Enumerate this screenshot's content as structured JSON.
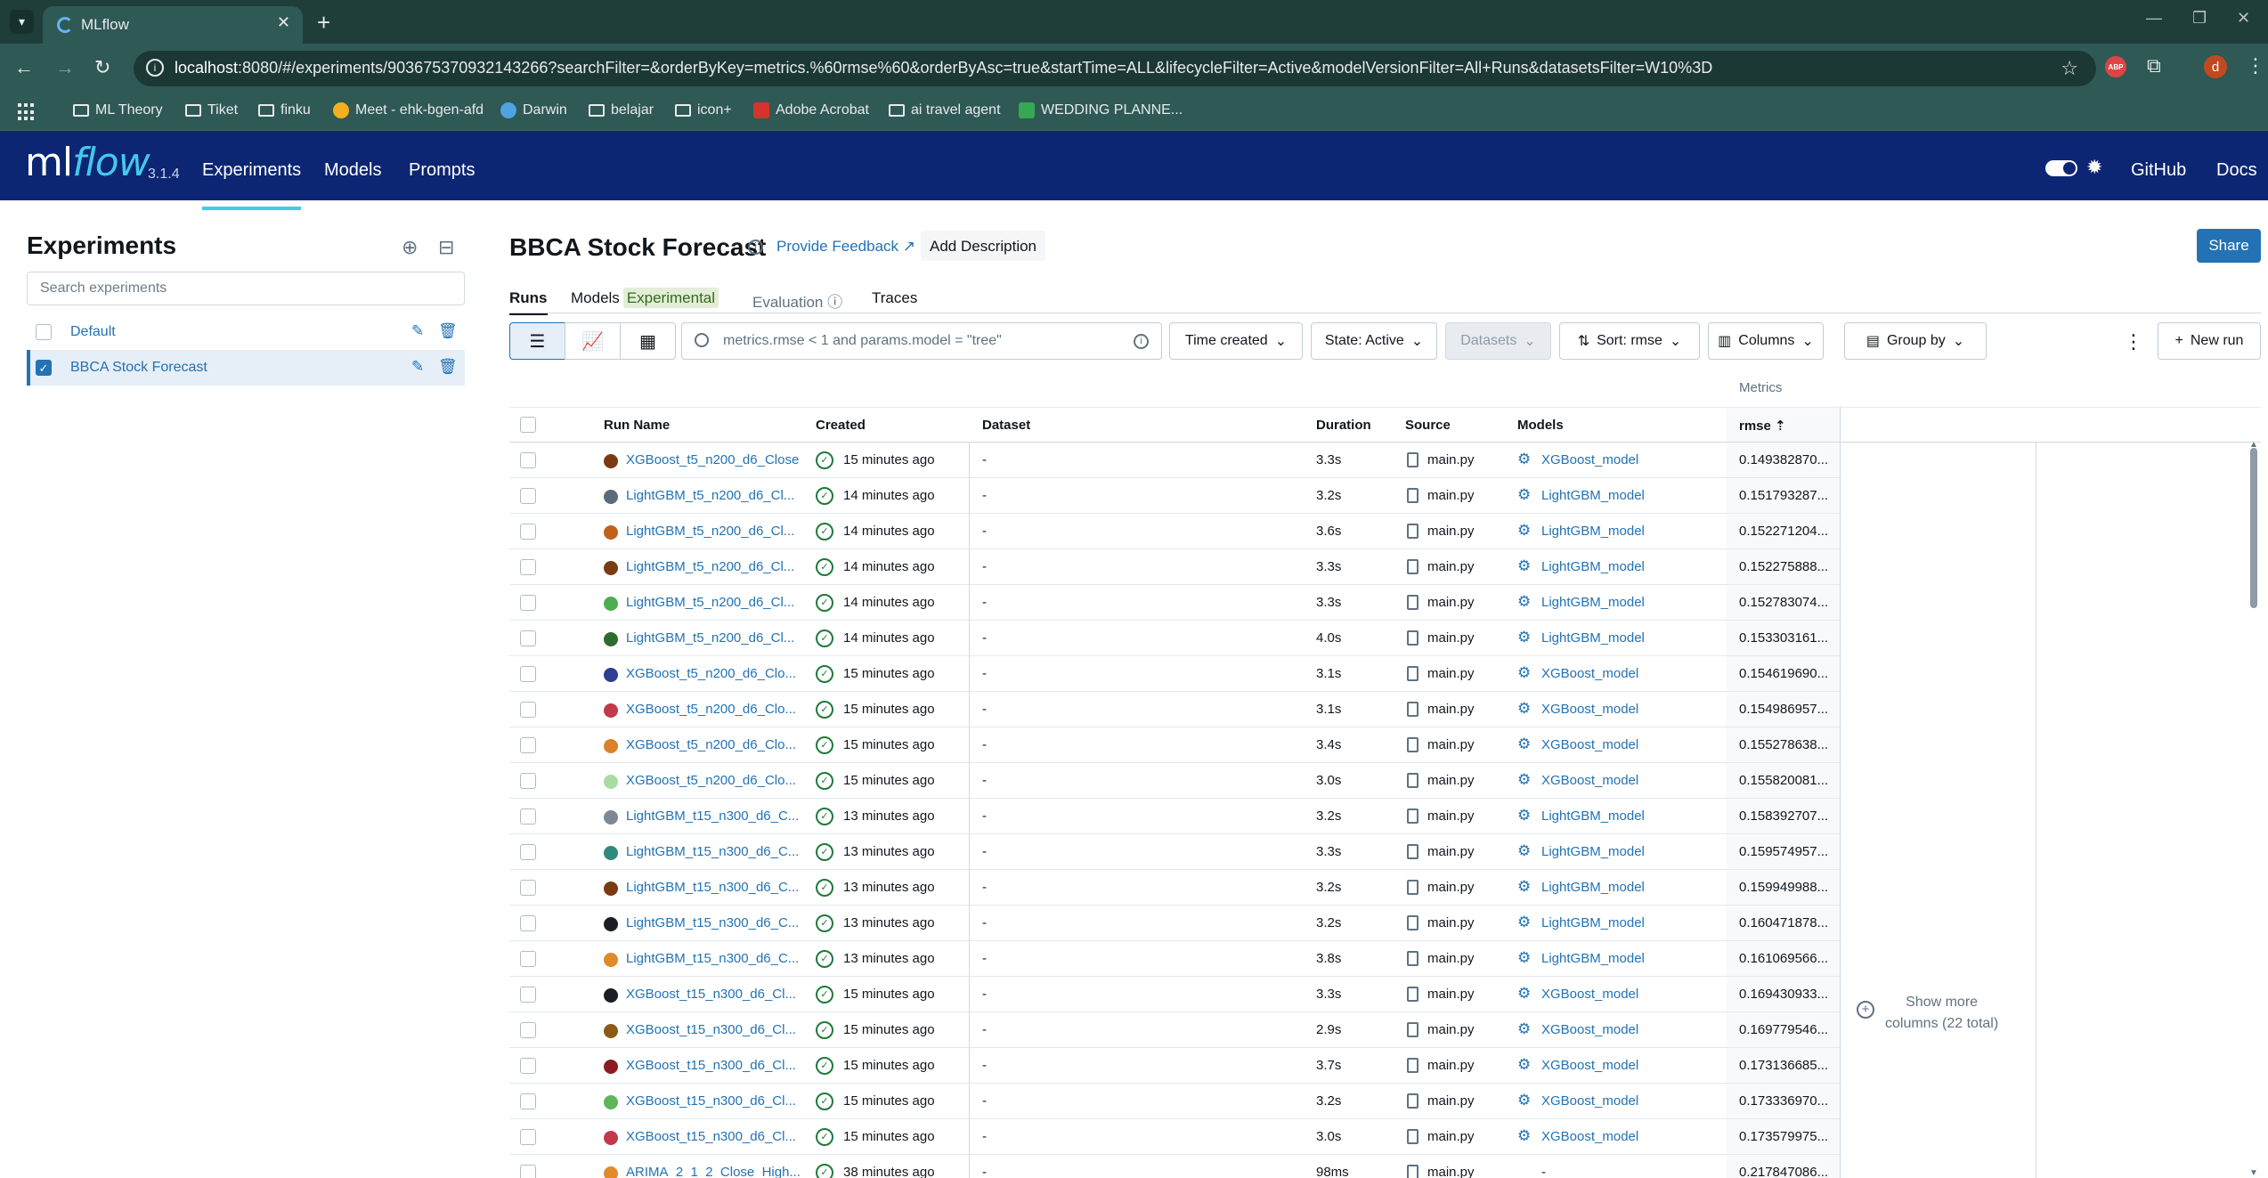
{
  "browser": {
    "tab_title": "MLflow",
    "url_host": "localhost",
    "url_rest": ":8080/#/experiments/903675370932143266?searchFilter=&orderByKey=metrics.%60rmse%60&orderByAsc=true&startTime=ALL&lifecycleFilter=Active&modelVersionFilter=All+Runs&datasetsFilter=W10%3D",
    "profile_initial": "d",
    "abp_label": "ABP",
    "bookmarks": [
      {
        "label": "ML Theory",
        "icon": "folder-icon"
      },
      {
        "label": "Tiket",
        "icon": "folder-icon"
      },
      {
        "label": "finku",
        "icon": "folder-icon"
      },
      {
        "label": "Meet - ehk-bgen-afd",
        "icon": "meet-icon"
      },
      {
        "label": "Darwin",
        "icon": "darwin-icon"
      },
      {
        "label": "belajar",
        "icon": "folder-icon"
      },
      {
        "label": "icon+",
        "icon": "folder-icon"
      },
      {
        "label": "Adobe Acrobat",
        "icon": "acrobat-icon"
      },
      {
        "label": "ai travel agent",
        "icon": "folder-icon"
      },
      {
        "label": "WEDDING PLANNE...",
        "icon": "sheets-icon"
      }
    ]
  },
  "header": {
    "logo_ml": "ml",
    "logo_flow": "flow",
    "version": "3.1.4",
    "nav": [
      "Experiments",
      "Models",
      "Prompts"
    ],
    "github": "GitHub",
    "docs": "Docs",
    "brand_color": "#0d2673",
    "accent_color": "#43c9ed"
  },
  "sidebar": {
    "title": "Experiments",
    "search_placeholder": "Search experiments",
    "experiments": [
      {
        "name": "Default",
        "checked": false
      },
      {
        "name": "BBCA Stock Forecast",
        "checked": true
      }
    ]
  },
  "main": {
    "title": "BBCA Stock Forecast",
    "feedback": "Provide Feedback",
    "add_description": "Add Description",
    "share": "Share",
    "tabs": {
      "runs": "Runs",
      "models": "Models",
      "models_badge": "Experimental",
      "evaluation": "Evaluation",
      "traces": "Traces"
    },
    "toolbar": {
      "search_placeholder": "metrics.rmse < 1 and params.model = \"tree\"",
      "time_created": "Time created",
      "state": "State: Active",
      "datasets": "Datasets",
      "sort": "Sort: rmse",
      "columns": "Columns",
      "group_by": "Group by",
      "new_run": "New run"
    },
    "table": {
      "group_header": "Metrics",
      "headers": {
        "run_name": "Run Name",
        "created": "Created",
        "dataset": "Dataset",
        "duration": "Duration",
        "source": "Source",
        "models": "Models",
        "rmse": "rmse"
      },
      "show_more_line1": "Show more",
      "show_more_line2": "columns (22 total)",
      "rows": [
        {
          "name": "XGBoost_t5_n200_d6_Close",
          "color": "#7a3b12",
          "created": "15 minutes ago",
          "dataset": "-",
          "duration": "3.3s",
          "source": "main.py",
          "model": "XGBoost_model",
          "rmse": "0.149382870..."
        },
        {
          "name": "LightGBM_t5_n200_d6_Cl...",
          "color": "#5b6b7b",
          "created": "14 minutes ago",
          "dataset": "-",
          "duration": "3.2s",
          "source": "main.py",
          "model": "LightGBM_model",
          "rmse": "0.151793287..."
        },
        {
          "name": "LightGBM_t5_n200_d6_Cl...",
          "color": "#c0621b",
          "created": "14 minutes ago",
          "dataset": "-",
          "duration": "3.6s",
          "source": "main.py",
          "model": "LightGBM_model",
          "rmse": "0.152271204..."
        },
        {
          "name": "LightGBM_t5_n200_d6_Cl...",
          "color": "#7a3b12",
          "created": "14 minutes ago",
          "dataset": "-",
          "duration": "3.3s",
          "source": "main.py",
          "model": "LightGBM_model",
          "rmse": "0.152275888..."
        },
        {
          "name": "LightGBM_t5_n200_d6_Cl...",
          "color": "#4cae52",
          "created": "14 minutes ago",
          "dataset": "-",
          "duration": "3.3s",
          "source": "main.py",
          "model": "LightGBM_model",
          "rmse": "0.152783074..."
        },
        {
          "name": "LightGBM_t5_n200_d6_Cl...",
          "color": "#2e6b2f",
          "created": "14 minutes ago",
          "dataset": "-",
          "duration": "4.0s",
          "source": "main.py",
          "model": "LightGBM_model",
          "rmse": "0.153303161..."
        },
        {
          "name": "XGBoost_t5_n200_d6_Clo...",
          "color": "#2e3f8f",
          "created": "15 minutes ago",
          "dataset": "-",
          "duration": "3.1s",
          "source": "main.py",
          "model": "XGBoost_model",
          "rmse": "0.154619690..."
        },
        {
          "name": "XGBoost_t5_n200_d6_Clo...",
          "color": "#c2394b",
          "created": "15 minutes ago",
          "dataset": "-",
          "duration": "3.1s",
          "source": "main.py",
          "model": "XGBoost_model",
          "rmse": "0.154986957..."
        },
        {
          "name": "XGBoost_t5_n200_d6_Clo...",
          "color": "#d9822b",
          "created": "15 minutes ago",
          "dataset": "-",
          "duration": "3.4s",
          "source": "main.py",
          "model": "XGBoost_model",
          "rmse": "0.155278638..."
        },
        {
          "name": "XGBoost_t5_n200_d6_Clo...",
          "color": "#a8dca3",
          "created": "15 minutes ago",
          "dataset": "-",
          "duration": "3.0s",
          "source": "main.py",
          "model": "XGBoost_model",
          "rmse": "0.155820081..."
        },
        {
          "name": "LightGBM_t15_n300_d6_C...",
          "color": "#7d8894",
          "created": "13 minutes ago",
          "dataset": "-",
          "duration": "3.2s",
          "source": "main.py",
          "model": "LightGBM_model",
          "rmse": "0.158392707..."
        },
        {
          "name": "LightGBM_t15_n300_d6_C...",
          "color": "#2f8a7e",
          "created": "13 minutes ago",
          "dataset": "-",
          "duration": "3.3s",
          "source": "main.py",
          "model": "LightGBM_model",
          "rmse": "0.159574957..."
        },
        {
          "name": "LightGBM_t15_n300_d6_C...",
          "color": "#7a3b12",
          "created": "13 minutes ago",
          "dataset": "-",
          "duration": "3.2s",
          "source": "main.py",
          "model": "LightGBM_model",
          "rmse": "0.159949988..."
        },
        {
          "name": "LightGBM_t15_n300_d6_C...",
          "color": "#1b1e24",
          "created": "13 minutes ago",
          "dataset": "-",
          "duration": "3.2s",
          "source": "main.py",
          "model": "LightGBM_model",
          "rmse": "0.160471878..."
        },
        {
          "name": "LightGBM_t15_n300_d6_C...",
          "color": "#e08a2a",
          "created": "13 minutes ago",
          "dataset": "-",
          "duration": "3.8s",
          "source": "main.py",
          "model": "LightGBM_model",
          "rmse": "0.161069566..."
        },
        {
          "name": "XGBoost_t15_n300_d6_Cl...",
          "color": "#1b1e24",
          "created": "15 minutes ago",
          "dataset": "-",
          "duration": "3.3s",
          "source": "main.py",
          "model": "XGBoost_model",
          "rmse": "0.169430933..."
        },
        {
          "name": "XGBoost_t15_n300_d6_Cl...",
          "color": "#8c5a14",
          "created": "15 minutes ago",
          "dataset": "-",
          "duration": "2.9s",
          "source": "main.py",
          "model": "XGBoost_model",
          "rmse": "0.169779546..."
        },
        {
          "name": "XGBoost_t15_n300_d6_Cl...",
          "color": "#8a1c22",
          "created": "15 minutes ago",
          "dataset": "-",
          "duration": "3.7s",
          "source": "main.py",
          "model": "XGBoost_model",
          "rmse": "0.173136685..."
        },
        {
          "name": "XGBoost_t15_n300_d6_Cl...",
          "color": "#5fb55a",
          "created": "15 minutes ago",
          "dataset": "-",
          "duration": "3.2s",
          "source": "main.py",
          "model": "XGBoost_model",
          "rmse": "0.173336970..."
        },
        {
          "name": "XGBoost_t15_n300_d6_Cl...",
          "color": "#c2394b",
          "created": "15 minutes ago",
          "dataset": "-",
          "duration": "3.0s",
          "source": "main.py",
          "model": "XGBoost_model",
          "rmse": "0.173579975..."
        },
        {
          "name": "ARIMA_2_1_2_Close_High...",
          "color": "#e08a2a",
          "created": "38 minutes ago",
          "dataset": "-",
          "duration": "98ms",
          "source": "main.py",
          "model": "-",
          "rmse": "0.217847086..."
        }
      ]
    }
  }
}
